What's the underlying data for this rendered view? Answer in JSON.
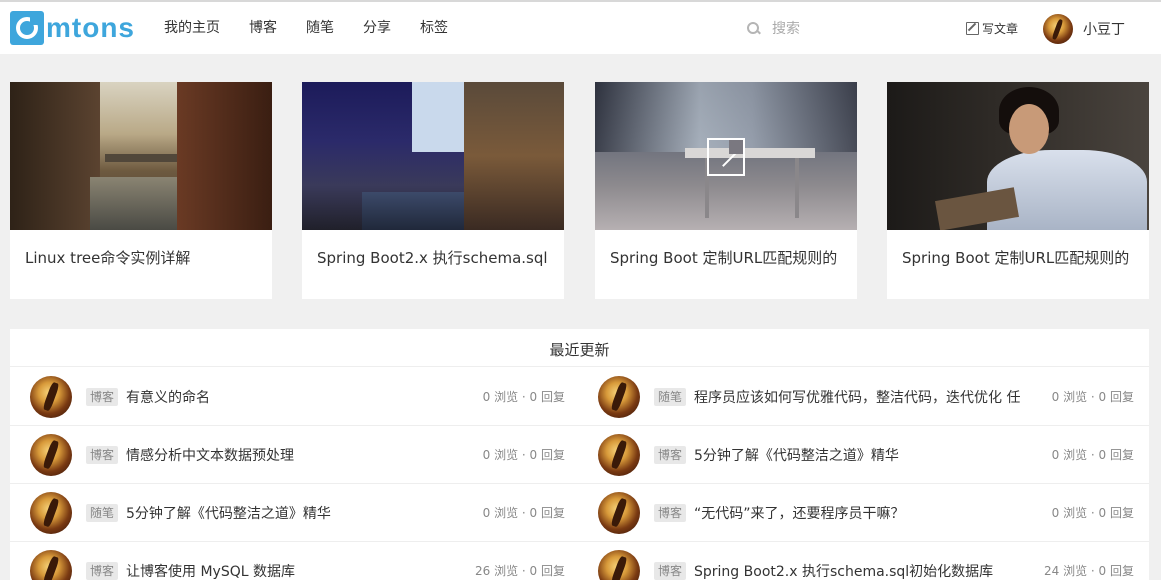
{
  "header": {
    "logo_text": "mtons",
    "nav": [
      "我的主页",
      "博客",
      "随笔",
      "分享",
      "标签"
    ],
    "search_placeholder": "搜索",
    "write_label": "写文章",
    "user_name": "小豆丁"
  },
  "cards": [
    {
      "title": "Linux tree命令实例详解"
    },
    {
      "title": "Spring Boot2.x 执行schema.sql"
    },
    {
      "title": "Spring Boot 定制URL匹配规则的"
    },
    {
      "title": "Spring Boot 定制URL匹配规则的"
    }
  ],
  "recent": {
    "title": "最近更新",
    "rows": [
      {
        "left": {
          "tag": "博客",
          "title": "有意义的命名",
          "stats": "0 浏览 · 0 回复"
        },
        "right": {
          "tag": "随笔",
          "title": "程序员应该如何写优雅代码，整洁代码，迭代优化 任",
          "stats": "0 浏览 · 0 回复"
        }
      },
      {
        "left": {
          "tag": "博客",
          "title": "情感分析中文本数据预处理",
          "stats": "0 浏览 · 0 回复"
        },
        "right": {
          "tag": "博客",
          "title": "5分钟了解《代码整洁之道》精华",
          "stats": "0 浏览 · 0 回复"
        }
      },
      {
        "left": {
          "tag": "随笔",
          "title": "5分钟了解《代码整洁之道》精华",
          "stats": "0 浏览 · 0 回复"
        },
        "right": {
          "tag": "博客",
          "title": "“无代码”来了，还要程序员干嘛？",
          "stats": "0 浏览 · 0 回复"
        }
      },
      {
        "left": {
          "tag": "博客",
          "title": "让博客使用 MySQL 数据库",
          "stats": "26 浏览 · 0 回复"
        },
        "right": {
          "tag": "博客",
          "title": "Spring Boot2.x 执行schema.sql初始化数据库",
          "stats": "24 浏览 · 0 回复"
        }
      }
    ]
  }
}
